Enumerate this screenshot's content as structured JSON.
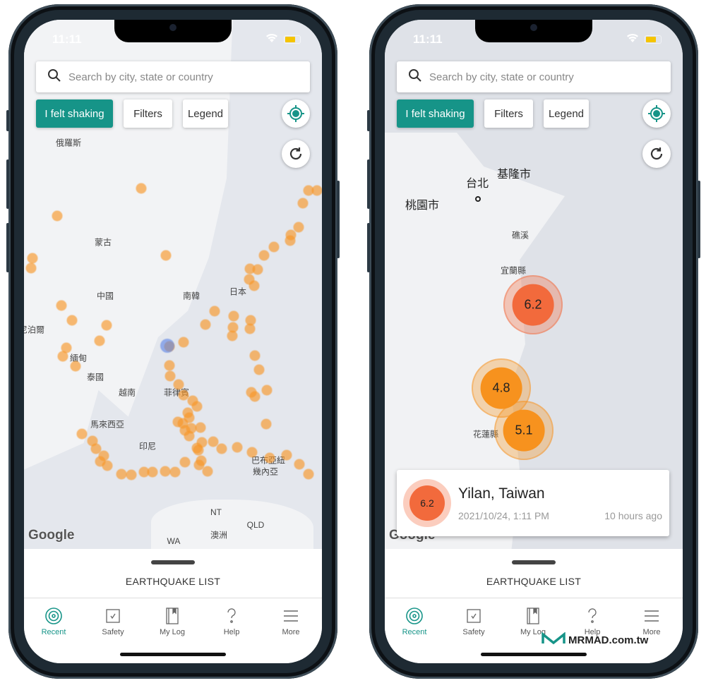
{
  "phones": [
    {
      "status": {
        "time": "11:11"
      },
      "search": {
        "placeholder": "Search by city, state or country"
      },
      "buttons": {
        "felt": "I felt shaking",
        "filters": "Filters",
        "legend": "Legend"
      },
      "map_labels": [
        "俄羅斯",
        "蒙古",
        "中國",
        "南韓",
        "日本",
        "尼泊爾",
        "緬甸",
        "泰國",
        "越南",
        "菲律賓",
        "馬來西亞",
        "印尼",
        "巴布亞紐",
        "幾內亞",
        "NT",
        "QLD",
        "澳洲",
        "WA"
      ],
      "google": "Google",
      "sheet_title": "EARTHQUAKE LIST",
      "tabs": [
        {
          "label": "Recent",
          "icon": "target-icon",
          "active": true
        },
        {
          "label": "Safety",
          "icon": "checkbox-icon"
        },
        {
          "label": "My Log",
          "icon": "book-icon"
        },
        {
          "label": "Help",
          "icon": "question-icon"
        },
        {
          "label": "More",
          "icon": "menu-icon"
        }
      ]
    },
    {
      "status": {
        "time": "11:11"
      },
      "search": {
        "placeholder": "Search by city, state or country"
      },
      "buttons": {
        "felt": "I felt shaking",
        "filters": "Filters",
        "legend": "Legend"
      },
      "map_labels": [
        "台北",
        "基隆市",
        "桃園市",
        "礁溪",
        "宜蘭縣",
        "花蓮縣"
      ],
      "quakes": [
        {
          "magnitude": "6.2",
          "color": "#f26a3c"
        },
        {
          "magnitude": "4.8",
          "color": "#f7921e"
        },
        {
          "magnitude": "5.1",
          "color": "#f7921e"
        }
      ],
      "selected": {
        "magnitude": "6.2",
        "place": "Yilan, Taiwan",
        "datetime": "2021/10/24, 1:11 PM",
        "ago": "10 hours ago"
      },
      "google": "Google",
      "sheet_title": "EARTHQUAKE LIST",
      "tabs": [
        {
          "label": "Recent",
          "icon": "target-icon",
          "active": true
        },
        {
          "label": "Safety",
          "icon": "checkbox-icon"
        },
        {
          "label": "My Log",
          "icon": "book-icon"
        },
        {
          "label": "Help",
          "icon": "question-icon"
        },
        {
          "label": "More",
          "icon": "menu-icon"
        }
      ]
    }
  ],
  "watermark": "MRMAD.com.tw",
  "colors": {
    "accent": "#169488",
    "quake_strong": "#f26a3c",
    "quake_moderate": "#f7921e"
  }
}
